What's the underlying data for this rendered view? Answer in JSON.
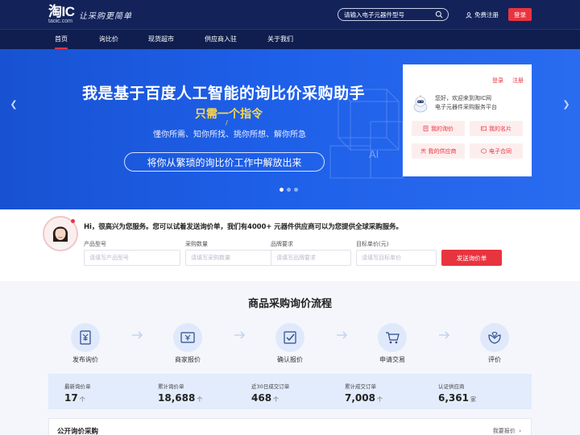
{
  "header": {
    "logo_main": "淘IC",
    "logo_sub": "taoic.com",
    "slogan": "让采购更简单",
    "search_placeholder": "请输入电子元器件型号",
    "register_label": "免费注册",
    "login_label": "登录"
  },
  "nav": {
    "items": [
      {
        "label": "首页",
        "active": true
      },
      {
        "label": "询比价"
      },
      {
        "label": "现货超市"
      },
      {
        "label": "供应商入驻"
      },
      {
        "label": "关于我们"
      }
    ]
  },
  "hero": {
    "title": "我是基于百度人工智能的询比价采购助手",
    "subtitle": "只需一个指令",
    "slash": "/",
    "desc": "懂你所需、知你所找、挑你所想、解你所急",
    "pill": "将你从繁琐的询比价工作中解放出来",
    "slides": 3,
    "active_slide": 1
  },
  "panel": {
    "login": "登录",
    "register": "注册",
    "greeting_line1": "您好，欢迎来到淘IC网",
    "greeting_line2": "电子元器件采购服务平台",
    "buttons": [
      "我的询价",
      "我的名片",
      "我的供应商",
      "电子合同"
    ]
  },
  "inquiry": {
    "intro": "Hi，很高兴为您服务。您可以试着发送询价单，我们有4000+ 元器件供应商可以为您提供全球采购服务。",
    "fields": [
      {
        "label": "产品型号",
        "placeholder": "请填写产品型号"
      },
      {
        "label": "采购数量",
        "placeholder": "请填写采购数量"
      },
      {
        "label": "品牌要求",
        "placeholder": "请填写品牌要求"
      },
      {
        "label": "目标单价(元)",
        "placeholder": "请填写目标单价"
      }
    ],
    "submit": "发送询价单"
  },
  "process": {
    "title": "商品采购询价流程",
    "steps": [
      "发布询价",
      "商家报价",
      "确认报价",
      "申请交易",
      "评价"
    ]
  },
  "stats": [
    {
      "label": "最新询价单",
      "value": "17",
      "unit": "个"
    },
    {
      "label": "累计询价单",
      "value": "18,688",
      "unit": "个"
    },
    {
      "label": "近30日成交订单",
      "value": "468",
      "unit": "个"
    },
    {
      "label": "累计成交订单",
      "value": "7,008",
      "unit": "个"
    },
    {
      "label": "认证供应商",
      "value": "6,361",
      "unit": "家"
    }
  ],
  "open": {
    "title": "公开询价采购",
    "more": "我要报价"
  },
  "colors": {
    "brand_red": "#e8343f",
    "header_navy": "#13235a",
    "hero_blue": "#1e5fe8",
    "highlight_yellow": "#ffd84a"
  }
}
